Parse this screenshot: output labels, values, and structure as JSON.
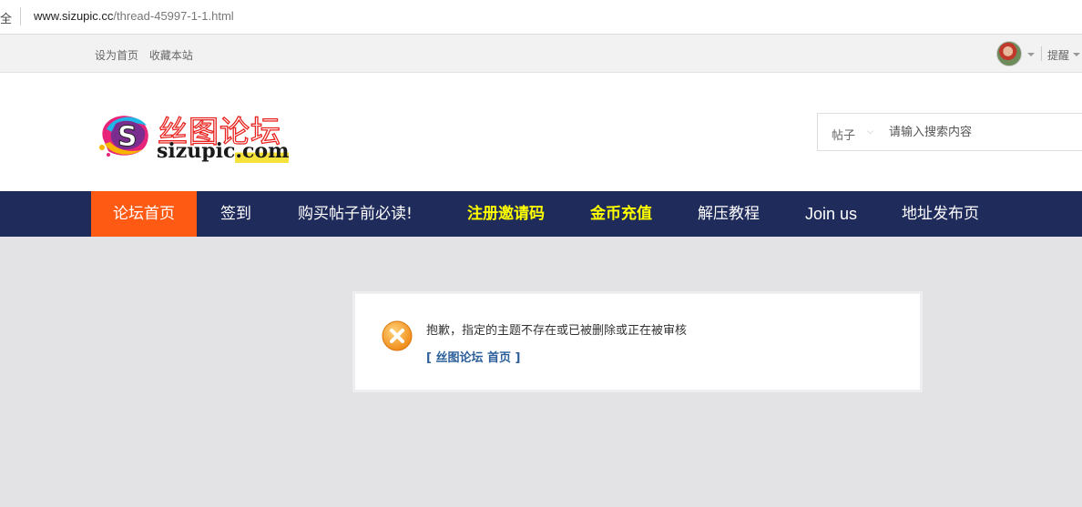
{
  "browser": {
    "security_label": "全",
    "url_host": "www.sizupic.cc",
    "url_path": "/thread-45997-1-1.html"
  },
  "topbar": {
    "links": [
      "设为首页",
      "收藏本站"
    ],
    "remind_label": "提醒"
  },
  "logo": {
    "title_cn": "丝图论坛",
    "domain_name": "sizupic",
    "domain_tld": ".com"
  },
  "search": {
    "type_label": "帖子",
    "placeholder": "请输入搜索内容"
  },
  "nav": {
    "items": [
      {
        "label": "论坛首页",
        "active": true
      },
      {
        "label": "签到"
      },
      {
        "label": "购买帖子前必读!"
      },
      {
        "label": "注册邀请码",
        "highlight": true
      },
      {
        "label": "金币充值",
        "highlight": true
      },
      {
        "label": "解压教程"
      },
      {
        "label": "Join us"
      },
      {
        "label": "地址发布页"
      }
    ]
  },
  "message": {
    "text": "抱歉，指定的主题不存在或已被删除或正在被审核",
    "link_label": "[ 丝图论坛 首页 ]"
  },
  "colors": {
    "nav_bg": "#1f2b5a",
    "nav_active": "#ff5a14",
    "nav_highlight": "#ffff00",
    "link": "#2b5f9a",
    "page_bg": "#e3e3e6"
  }
}
